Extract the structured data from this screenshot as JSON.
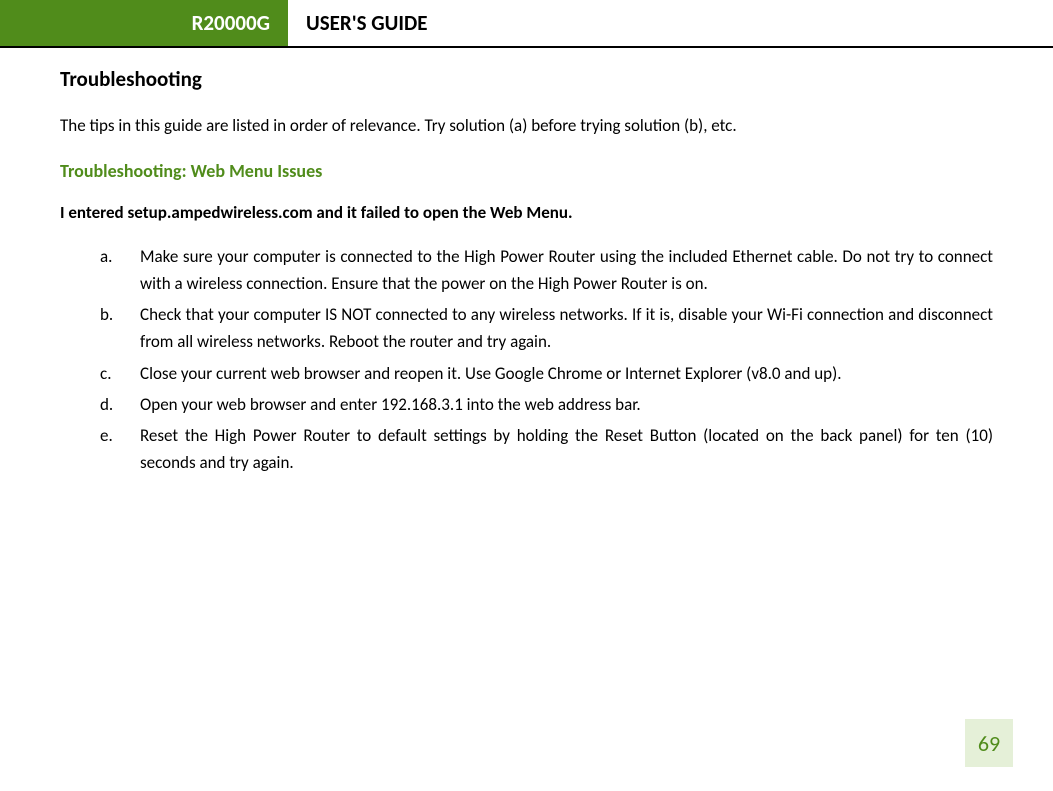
{
  "header": {
    "model": "R20000G",
    "guide_label": "USER'S GUIDE"
  },
  "title": "Troubleshooting",
  "intro": "The tips in this guide are listed in order of relevance.  Try solution (a) before trying solution (b), etc.",
  "subheading": "Troubleshooting: Web Menu Issues",
  "question": "I entered setup.ampedwireless.com and it failed to open the Web Menu.",
  "list": {
    "a": {
      "marker": "a.",
      "text": "Make sure your computer is connected to the High Power Router using the included Ethernet cable.  Do not try to connect with a wireless connection.  Ensure that the power on the High Power Router is on."
    },
    "b": {
      "marker": "b.",
      "text": "Check that your computer IS NOT connected to any wireless networks.  If it is, disable your Wi-Fi connection and disconnect from all wireless networks.  Reboot the router and try again."
    },
    "c": {
      "marker": "c.",
      "text": "Close your current web browser and reopen it.  Use Google Chrome or Internet Explorer (v8.0 and up)."
    },
    "d": {
      "marker": "d.",
      "text": "Open your web browser and enter 192.168.3.1 into the web address bar."
    },
    "e": {
      "marker": "e.",
      "text": "Reset the High Power Router to default settings by holding the Reset Button (located on the back panel) for ten (10) seconds and try again."
    }
  },
  "page_number": "69"
}
